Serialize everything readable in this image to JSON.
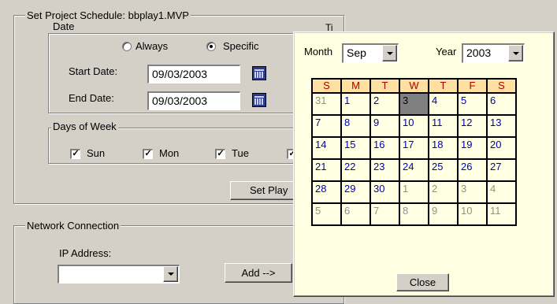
{
  "schedule": {
    "legend": "Set Project Schedule: bbplay1.MVP",
    "date": {
      "legend": "Date",
      "radio_always": "Always",
      "radio_specific": "Specific",
      "selected": "specific",
      "start_label": "Start Date:",
      "start_value": "09/03/2003",
      "end_label": "End Date:",
      "end_value": "09/03/2003"
    },
    "time_legend_partial": "Ti",
    "days": {
      "legend": "Days of Week",
      "items": [
        {
          "label": "Sun",
          "checked": true
        },
        {
          "label": "Mon",
          "checked": true
        },
        {
          "label": "Tue",
          "checked": true
        }
      ]
    },
    "set_play_button": "Set Play"
  },
  "network": {
    "legend": "Network Connection",
    "ip_label": "IP Address:",
    "ip_value": "",
    "add_button": "Add -->"
  },
  "calendar": {
    "month_label": "Month",
    "month_value": "Sep",
    "year_label": "Year",
    "year_value": "2003",
    "weekdays": [
      "S",
      "M",
      "T",
      "W",
      "T",
      "F",
      "S"
    ],
    "weeks": [
      [
        {
          "d": "31",
          "t": "other"
        },
        {
          "d": "1",
          "t": "cur"
        },
        {
          "d": "2",
          "t": "cur"
        },
        {
          "d": "3",
          "t": "selected"
        },
        {
          "d": "4",
          "t": "cur"
        },
        {
          "d": "5",
          "t": "cur"
        },
        {
          "d": "6",
          "t": "cur"
        }
      ],
      [
        {
          "d": "7",
          "t": "cur"
        },
        {
          "d": "8",
          "t": "cur"
        },
        {
          "d": "9",
          "t": "cur"
        },
        {
          "d": "10",
          "t": "cur"
        },
        {
          "d": "11",
          "t": "cur"
        },
        {
          "d": "12",
          "t": "cur"
        },
        {
          "d": "13",
          "t": "cur"
        }
      ],
      [
        {
          "d": "14",
          "t": "cur"
        },
        {
          "d": "15",
          "t": "cur"
        },
        {
          "d": "16",
          "t": "cur"
        },
        {
          "d": "17",
          "t": "cur"
        },
        {
          "d": "18",
          "t": "cur"
        },
        {
          "d": "19",
          "t": "cur"
        },
        {
          "d": "20",
          "t": "cur"
        }
      ],
      [
        {
          "d": "21",
          "t": "cur"
        },
        {
          "d": "22",
          "t": "cur"
        },
        {
          "d": "23",
          "t": "cur"
        },
        {
          "d": "24",
          "t": "cur"
        },
        {
          "d": "25",
          "t": "cur"
        },
        {
          "d": "26",
          "t": "cur"
        },
        {
          "d": "27",
          "t": "cur"
        }
      ],
      [
        {
          "d": "28",
          "t": "cur"
        },
        {
          "d": "29",
          "t": "cur"
        },
        {
          "d": "30",
          "t": "cur"
        },
        {
          "d": "1",
          "t": "other"
        },
        {
          "d": "2",
          "t": "other"
        },
        {
          "d": "3",
          "t": "other"
        },
        {
          "d": "4",
          "t": "other"
        }
      ],
      [
        {
          "d": "5",
          "t": "other"
        },
        {
          "d": "6",
          "t": "other"
        },
        {
          "d": "7",
          "t": "other"
        },
        {
          "d": "8",
          "t": "other"
        },
        {
          "d": "9",
          "t": "other"
        },
        {
          "d": "10",
          "t": "other"
        },
        {
          "d": "11",
          "t": "other"
        }
      ]
    ],
    "close_button": "Close"
  },
  "colors": {
    "window_bg": "#d4d0c8",
    "popup_bg": "#ffffe1",
    "weekday_header_bg": "#ffe0a0",
    "weekday_header_text": "#b00000",
    "current_month_text": "#0000b0",
    "other_month_text": "#909090",
    "selected_day_bg": "#808080"
  }
}
